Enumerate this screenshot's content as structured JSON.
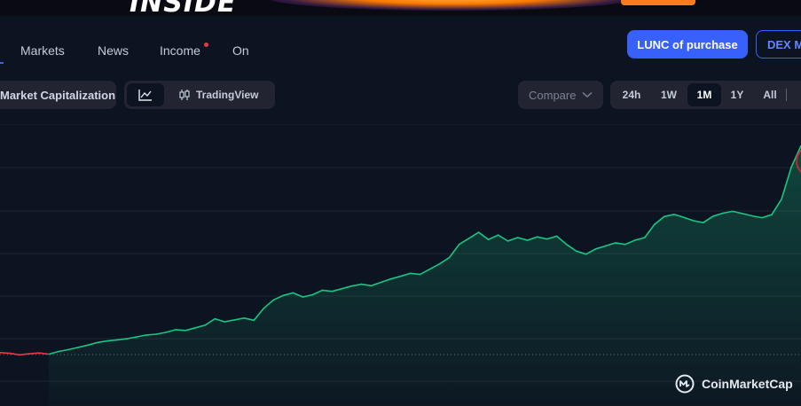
{
  "banner": {
    "text": "INSIDE"
  },
  "nav": {
    "items": [
      {
        "label": "Markets"
      },
      {
        "label": "News"
      },
      {
        "label": "Income",
        "has_dot": true
      },
      {
        "label": "On"
      }
    ]
  },
  "actions": {
    "buy_label": "LUNC of purchase",
    "dex_label": "DEX M"
  },
  "toolbar": {
    "metric_label": "Market Capitalization",
    "line_chart_icon": "line-chart-icon",
    "tradingview_label": "TradingView",
    "compare_label": "Compare",
    "ranges": [
      "24h",
      "1W",
      "1M",
      "1Y",
      "All"
    ],
    "active_range": "1M"
  },
  "watermark": {
    "label": "CoinMarketCap"
  },
  "colors": {
    "background": "#0d1421",
    "accent": "#3861fb",
    "up": "#16c784",
    "down": "#ea3943",
    "grid": "#222531"
  },
  "chart_data": {
    "type": "area",
    "title": "",
    "xlabel": "",
    "ylabel": "",
    "range": "1M",
    "grid": true,
    "baseline_dotted": true,
    "series": [
      {
        "values": [
          44.2,
          44.0,
          43.6,
          43.9,
          44.1,
          43.8,
          44.5,
          45.0,
          45.6,
          46.2,
          46.9,
          47.3,
          47.6,
          47.9,
          48.4,
          48.9,
          49.1,
          49.6,
          50.3,
          50.1,
          50.8,
          51.5,
          53.2,
          52.4,
          52.9,
          53.4,
          52.8,
          56.0,
          58.2,
          59.4,
          60.1,
          59.0,
          59.6,
          60.8,
          60.5,
          61.2,
          61.9,
          62.4,
          62.0,
          62.9,
          63.8,
          64.5,
          65.3,
          65.0,
          66.4,
          67.8,
          69.5,
          73.0,
          74.6,
          76.2,
          74.3,
          75.5,
          73.9,
          74.8,
          74.1,
          75.0,
          74.4,
          75.2,
          73.0,
          71.2,
          70.4,
          71.8,
          72.6,
          73.4,
          73.0,
          74.1,
          74.8,
          78.3,
          80.4,
          81.0,
          80.2,
          79.3,
          78.8,
          80.5,
          81.3,
          81.8,
          81.2,
          80.6,
          80.1,
          80.9,
          85.0,
          93.5,
          99.2
        ]
      }
    ]
  }
}
